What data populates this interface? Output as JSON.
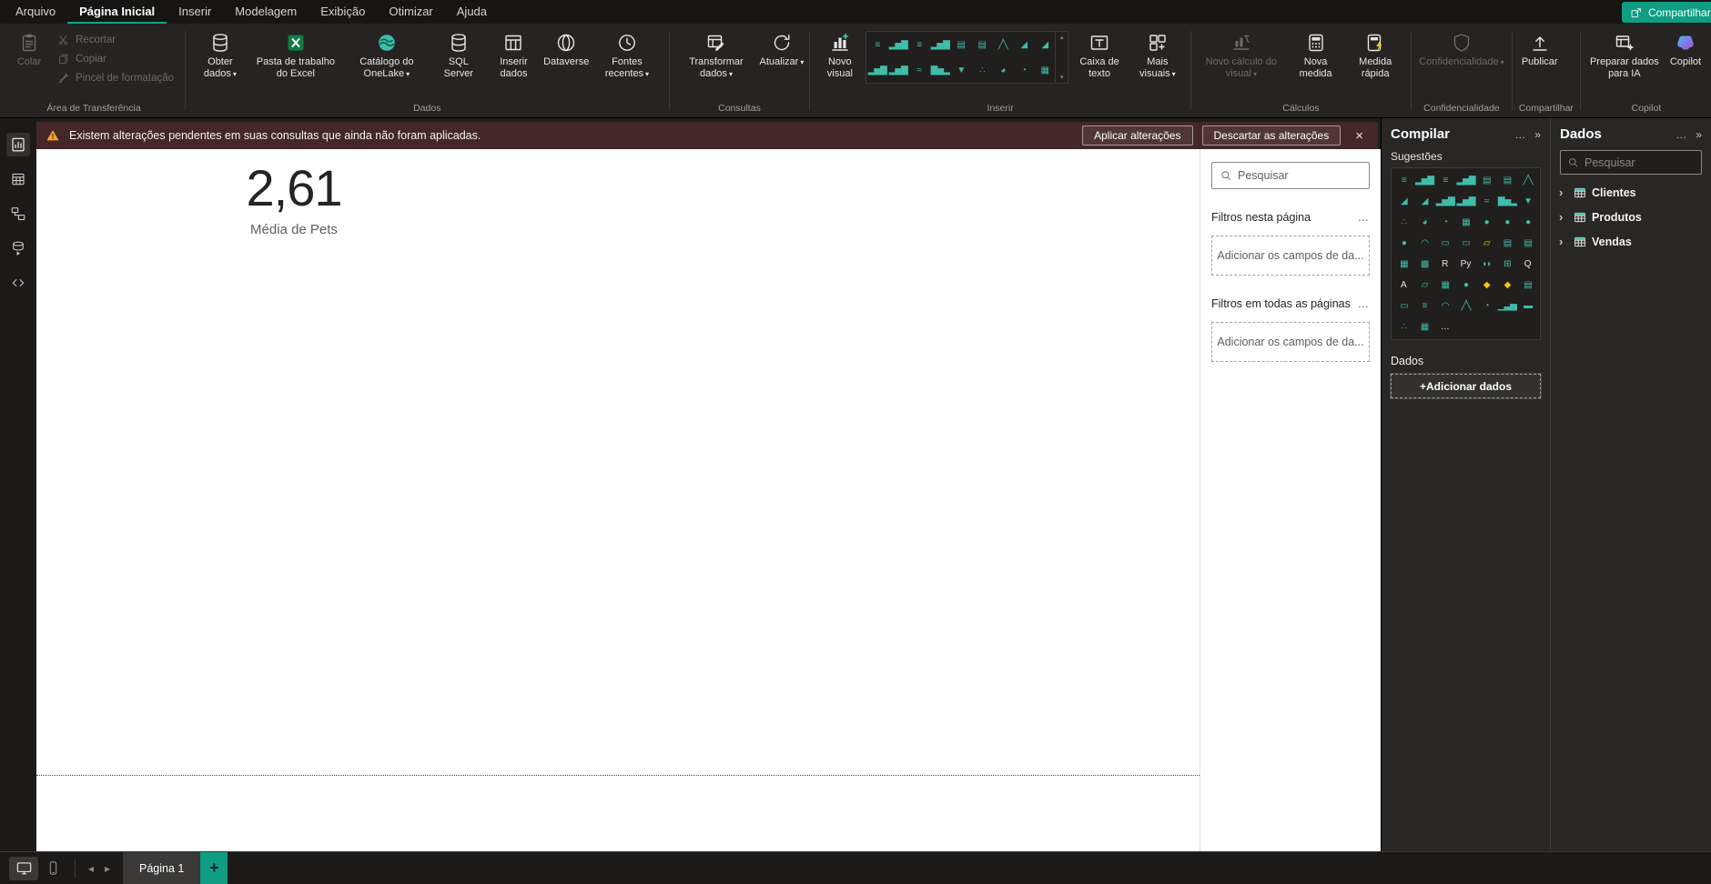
{
  "app": {
    "accent": "#0F9D83",
    "share_label": "Compartilhar"
  },
  "ui": {
    "ellipsis": "…",
    "collapse": "»",
    "close": "×"
  },
  "menu": {
    "items": [
      "Arquivo",
      "Página Inicial",
      "Inserir",
      "Modelagem",
      "Exibição",
      "Otimizar",
      "Ajuda"
    ],
    "active_index": 1
  },
  "ribbon": {
    "clipboard": {
      "paste_label": "Colar",
      "items": [
        {
          "label": "Recortar",
          "icon": "scissors-icon"
        },
        {
          "label": "Copiar",
          "icon": "copy-icon"
        },
        {
          "label": "Pincel de formatação",
          "icon": "format-painter-icon"
        }
      ],
      "group_label": "Área de Transferência"
    },
    "groups": [
      {
        "group_label": "Dados",
        "buttons": [
          {
            "label": "Obter dados",
            "icon": "get-data-icon",
            "chevron": true
          },
          {
            "label": "Pasta de trabalho do Excel",
            "icon": "excel-icon"
          },
          {
            "label": "Catálogo do OneLake",
            "icon": "onelake-icon",
            "chevron": true
          },
          {
            "label": "SQL Server",
            "icon": "sql-server-icon"
          },
          {
            "label": "Inserir dados",
            "icon": "enter-data-icon"
          },
          {
            "label": "Dataverse",
            "icon": "dataverse-icon"
          },
          {
            "label": "Fontes recentes",
            "icon": "recent-sources-icon",
            "chevron": true
          }
        ]
      },
      {
        "group_label": "Consultas",
        "buttons": [
          {
            "label": "Transformar dados",
            "icon": "transform-data-icon",
            "chevron": true
          },
          {
            "label": "Atualizar",
            "icon": "refresh-icon",
            "chevron": true
          }
        ]
      },
      {
        "group_label": "Inserir",
        "gallery": true,
        "buttons": [
          {
            "label": "Novo visual",
            "icon": "new-visual-icon"
          }
        ],
        "buttons_after": [
          {
            "label": "Caixa de texto",
            "icon": "text-box-icon"
          },
          {
            "label": "Mais visuais",
            "icon": "more-visuals-icon",
            "chevron": true
          }
        ]
      },
      {
        "group_label": "Cálculos",
        "buttons": [
          {
            "label": "Novo cálculo do visual",
            "icon": "visual-calculation-icon",
            "chevron": true,
            "disabled": true
          },
          {
            "label": "Nova medida",
            "icon": "new-measure-icon"
          },
          {
            "label": "Medida rápida",
            "icon": "quick-measure-icon"
          }
        ]
      },
      {
        "group_label": "Confidencialidade",
        "buttons": [
          {
            "label": "Confidencialidade",
            "icon": "sensitivity-icon",
            "chevron": true,
            "disabled": true
          }
        ]
      },
      {
        "group_label": "Compartilhar",
        "buttons": [
          {
            "label": "Publicar",
            "icon": "publish-icon"
          }
        ]
      },
      {
        "group_label": "Copilot",
        "buttons": [
          {
            "label": "Preparar dados para IA",
            "icon": "prepare-data-ai-icon"
          },
          {
            "label": "Copilot",
            "icon": "copilot-icon"
          }
        ]
      }
    ]
  },
  "banner": {
    "text": "Existem alterações pendentes em suas consultas que ainda não foram aplicadas.",
    "apply_label": "Aplicar alterações",
    "discard_label": "Descartar as alterações"
  },
  "canvas": {
    "card": {
      "value": "2,61",
      "label": "Média de Pets"
    }
  },
  "filters": {
    "search_placeholder": "Pesquisar",
    "sections": [
      {
        "title": "Filtros nesta página",
        "drop_label": "Adicionar os campos de da..."
      },
      {
        "title": "Filtros em todas as páginas",
        "drop_label": "Adicionar os campos de da..."
      }
    ]
  },
  "build_pane": {
    "title": "Compilar",
    "suggestions_label": "Sugestões",
    "data_label": "Dados",
    "add_data_label": "+Adicionar dados",
    "visuals": [
      "stacked-bar-chart",
      "stacked-column-chart",
      "clustered-bar-chart",
      "clustered-column-chart",
      "100-stacked-bar-chart",
      "100-stacked-column-chart",
      "line-chart",
      "area-chart",
      "stacked-area-chart",
      "line-and-stacked-column-chart",
      "line-and-clustered-column-chart",
      "ribbon-chart",
      "waterfall-chart",
      "funnel-chart",
      "scatter-chart",
      "pie-chart",
      "donut-chart",
      "treemap",
      "map",
      "filled-map",
      "shape-map",
      "azure-map",
      "gauge",
      "card",
      "multi-row-card",
      "kpi",
      "slicer",
      "button-slicer",
      "table",
      "matrix",
      "r-script-visual",
      "python-visual",
      "key-influencers",
      "decomposition-tree",
      "qa-visual",
      "smart-narrative",
      "metrics",
      "paginated-report",
      "arcgis-map",
      "power-apps",
      "power-automate",
      "text-slicer",
      "new-card",
      "accordion",
      "radial-gauge",
      "sparkline",
      "sunburst",
      "histogram",
      "bullet-chart",
      "dot-plot",
      "heatmap"
    ]
  },
  "data_pane": {
    "title": "Dados",
    "search_placeholder": "Pesquisar",
    "tables": [
      {
        "name": "Clientes"
      },
      {
        "name": "Produtos"
      },
      {
        "name": "Vendas"
      }
    ]
  },
  "pages_bar": {
    "page_tabs": [
      "Página 1"
    ]
  }
}
